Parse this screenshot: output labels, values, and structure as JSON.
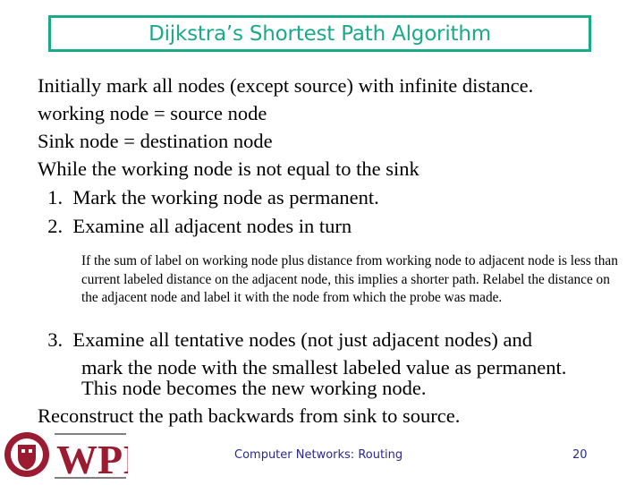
{
  "slide": {
    "title": "Dijkstra’s Shortest Path Algorithm",
    "lines": [
      "Initially mark all nodes (except source) with infinite distance.",
      "working node = source node",
      "Sink node  = destination node",
      "While the working node is not equal to the sink",
      "  1.  Mark the working node as permanent.",
      "  2.  Examine all adjacent nodes in turn"
    ],
    "sub_paragraph": "If the sum of label on working node plus distance from working node to adjacent node is less than current labeled distance on the adjacent node, this implies a shorter path. Relabel the distance on the adjacent node and label it with the node from which the probe was made.",
    "step3": [
      "  3.  Examine all tentative nodes (not just adjacent nodes) and",
      "mark the node with the smallest labeled value as permanent.",
      "This node becomes the new working node."
    ],
    "final_line": "Reconstruct the path backwards from sink to source."
  },
  "footer": {
    "logo_text": "WPI",
    "course": "Computer Networks: Routing",
    "page_number": "20"
  },
  "colors": {
    "title": "#1aaa8a",
    "footer_text": "#2a2a8c",
    "logo": "#9b1b30"
  }
}
